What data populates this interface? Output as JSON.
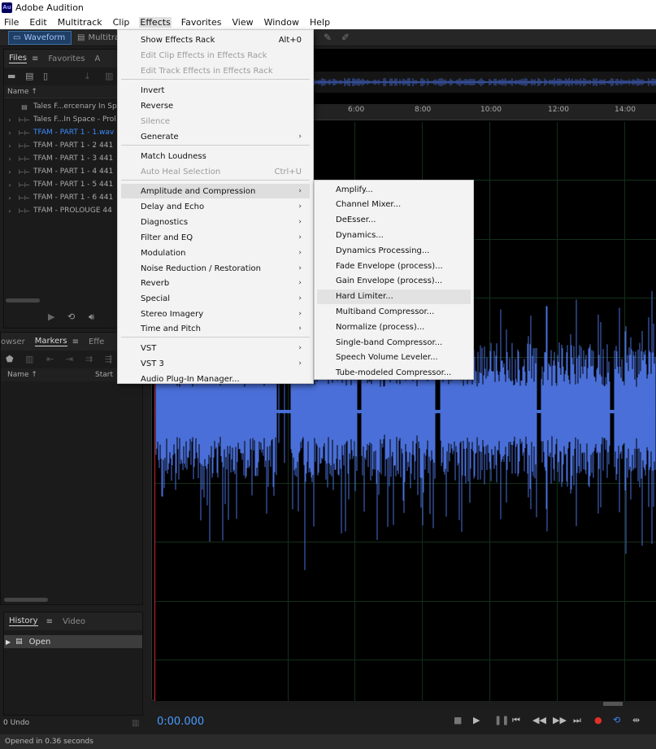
{
  "window": {
    "title": "Adobe Audition",
    "icon_text": "Au"
  },
  "menubar": [
    "File",
    "Edit",
    "Multitrack",
    "Clip",
    "Effects",
    "Favorites",
    "View",
    "Window",
    "Help"
  ],
  "modes": {
    "waveform": "Waveform",
    "multitrack": "Multitra"
  },
  "files_panel": {
    "tabs": [
      "Files",
      "Favorites",
      "A"
    ],
    "column_name": "Name ↑",
    "items": [
      {
        "name": "Tales F...ercenary In Spa",
        "type": "session",
        "selected": false
      },
      {
        "name": "Tales F...In Space - Prol",
        "type": "audio",
        "selected": false
      },
      {
        "name": "TFAM - PART 1 - 1.wav",
        "type": "audio",
        "selected": true
      },
      {
        "name": "TFAM - PART 1 - 2 441",
        "type": "audio",
        "selected": false
      },
      {
        "name": "TFAM - PART 1 - 3 441",
        "type": "audio",
        "selected": false
      },
      {
        "name": "TFAM - PART 1 - 4 441",
        "type": "audio",
        "selected": false
      },
      {
        "name": "TFAM - PART 1 - 5 441",
        "type": "audio",
        "selected": false
      },
      {
        "name": "TFAM - PART 1 - 6 441",
        "type": "audio",
        "selected": false
      },
      {
        "name": "TFAM - PROLOUGE 44",
        "type": "audio",
        "selected": false
      }
    ]
  },
  "markers_panel": {
    "tabs": [
      "owser",
      "Markers",
      "Effe"
    ],
    "col_name": "Name ↑",
    "col_start": "Start"
  },
  "history_panel": {
    "tabs": [
      "History",
      "Video"
    ],
    "items": [
      "Open"
    ],
    "undo_count": "0 Undo"
  },
  "ruler": {
    "ticks": [
      "6:00",
      "8:00",
      "10:00",
      "12:00",
      "14:00"
    ]
  },
  "effects_menu": [
    {
      "label": "Show Effects Rack",
      "shortcut": "Alt+0",
      "enabled": true
    },
    {
      "label": "Edit Clip Effects in Effects Rack",
      "enabled": false
    },
    {
      "label": "Edit Track Effects in Effects Rack",
      "enabled": false
    },
    {
      "label": "Invert",
      "enabled": true
    },
    {
      "label": "Reverse",
      "enabled": true
    },
    {
      "label": "Silence",
      "enabled": false
    },
    {
      "label": "Generate",
      "enabled": true,
      "submenu": true
    },
    {
      "label": "Match Loudness",
      "enabled": true
    },
    {
      "label": "Auto Heal Selection",
      "shortcut": "Ctrl+U",
      "enabled": false
    },
    {
      "label": "Amplitude and Compression",
      "enabled": true,
      "submenu": true,
      "highlighted": true
    },
    {
      "label": "Delay and Echo",
      "enabled": true,
      "submenu": true
    },
    {
      "label": "Diagnostics",
      "enabled": true,
      "submenu": true
    },
    {
      "label": "Filter and EQ",
      "enabled": true,
      "submenu": true
    },
    {
      "label": "Modulation",
      "enabled": true,
      "submenu": true
    },
    {
      "label": "Noise Reduction / Restoration",
      "enabled": true,
      "submenu": true
    },
    {
      "label": "Reverb",
      "enabled": true,
      "submenu": true
    },
    {
      "label": "Special",
      "enabled": true,
      "submenu": true
    },
    {
      "label": "Stereo Imagery",
      "enabled": true,
      "submenu": true
    },
    {
      "label": "Time and Pitch",
      "enabled": true,
      "submenu": true
    },
    {
      "label": "VST",
      "enabled": true,
      "submenu": true
    },
    {
      "label": "VST 3",
      "enabled": true,
      "submenu": true
    },
    {
      "label": "Audio Plug-In Manager...",
      "enabled": true
    }
  ],
  "amplitude_submenu": [
    {
      "label": "Amplify..."
    },
    {
      "label": "Channel Mixer..."
    },
    {
      "label": "DeEsser..."
    },
    {
      "label": "Dynamics..."
    },
    {
      "label": "Dynamics Processing..."
    },
    {
      "label": "Fade Envelope (process)..."
    },
    {
      "label": "Gain Envelope (process)..."
    },
    {
      "label": "Hard Limiter...",
      "highlighted": true
    },
    {
      "label": "Multiband Compressor..."
    },
    {
      "label": "Normalize (process)..."
    },
    {
      "label": "Single-band Compressor..."
    },
    {
      "label": "Speech Volume Leveler..."
    },
    {
      "label": "Tube-modeled Compressor..."
    }
  ],
  "transport": {
    "time": "0:00.000"
  },
  "status": {
    "text": "Opened in 0.36 seconds"
  },
  "colors": {
    "waveform": "#4a6fd8",
    "accent": "#3b8bff",
    "record": "#e0302a"
  }
}
